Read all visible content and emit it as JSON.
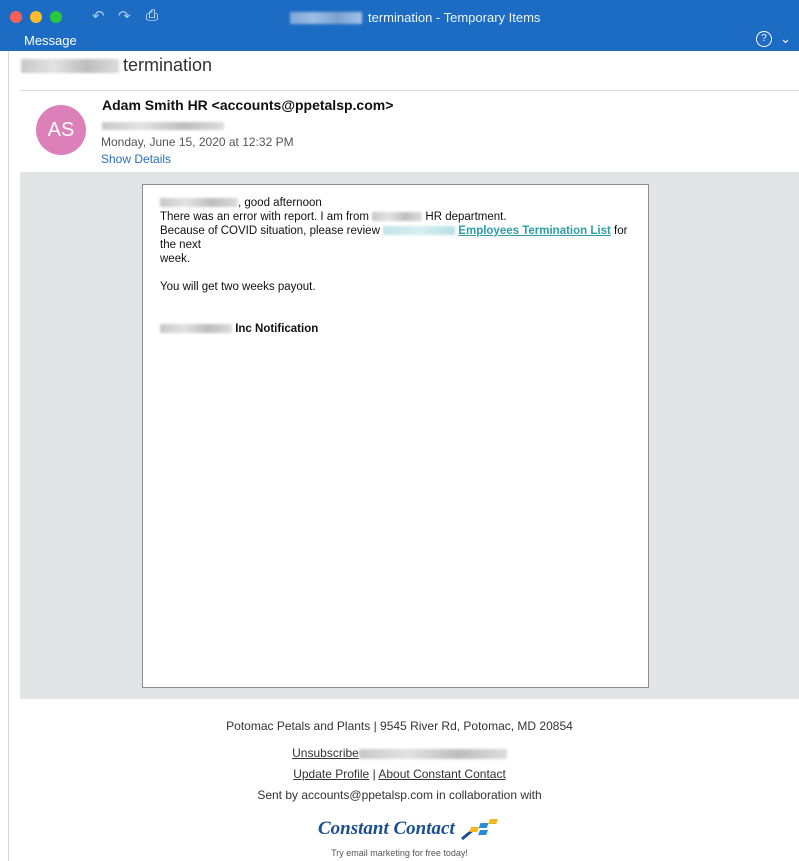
{
  "window": {
    "title_suffix": "termination - Temporary Items",
    "toolbar_label": "Message"
  },
  "message": {
    "subject": "termination",
    "sender_line": "Adam Smith HR <accounts@ppetalsp.com>",
    "avatar_initials": "AS",
    "date": "Monday, June 15, 2020 at 12:32 PM",
    "show_details": "Show Details",
    "avatar_color": "#db80b9"
  },
  "body": {
    "greeting": ", good afternoon",
    "line1a": "There was an error with report. I am from",
    "line1b": "HR department.",
    "line2a": "Because of COVID situation, please review",
    "link_text": "Employees Termination List",
    "line2b": "for the next",
    "line2c": "week.",
    "line3": "You will get two weeks payout.",
    "signature": "Inc Notification"
  },
  "footer": {
    "address": "Potomac Petals and Plants | 9545 River Rd, Potomac, MD 20854",
    "unsubscribe": "Unsubscribe",
    "update_profile": "Update Profile",
    "divider": "|",
    "about": "About Constant Contact",
    "sent_by": "Sent by accounts@ppetalsp.com in collaboration with",
    "logo_text": "Constant Contact",
    "tagline": "Try email marketing for free today!"
  },
  "colors": {
    "titlebar": "#1d6cc3",
    "link": "#2c9ea7",
    "accent_link": "#2a6fc0"
  },
  "icons": [
    "undo-icon",
    "redo-icon",
    "printer-icon",
    "help-icon",
    "chevron-down-icon"
  ]
}
